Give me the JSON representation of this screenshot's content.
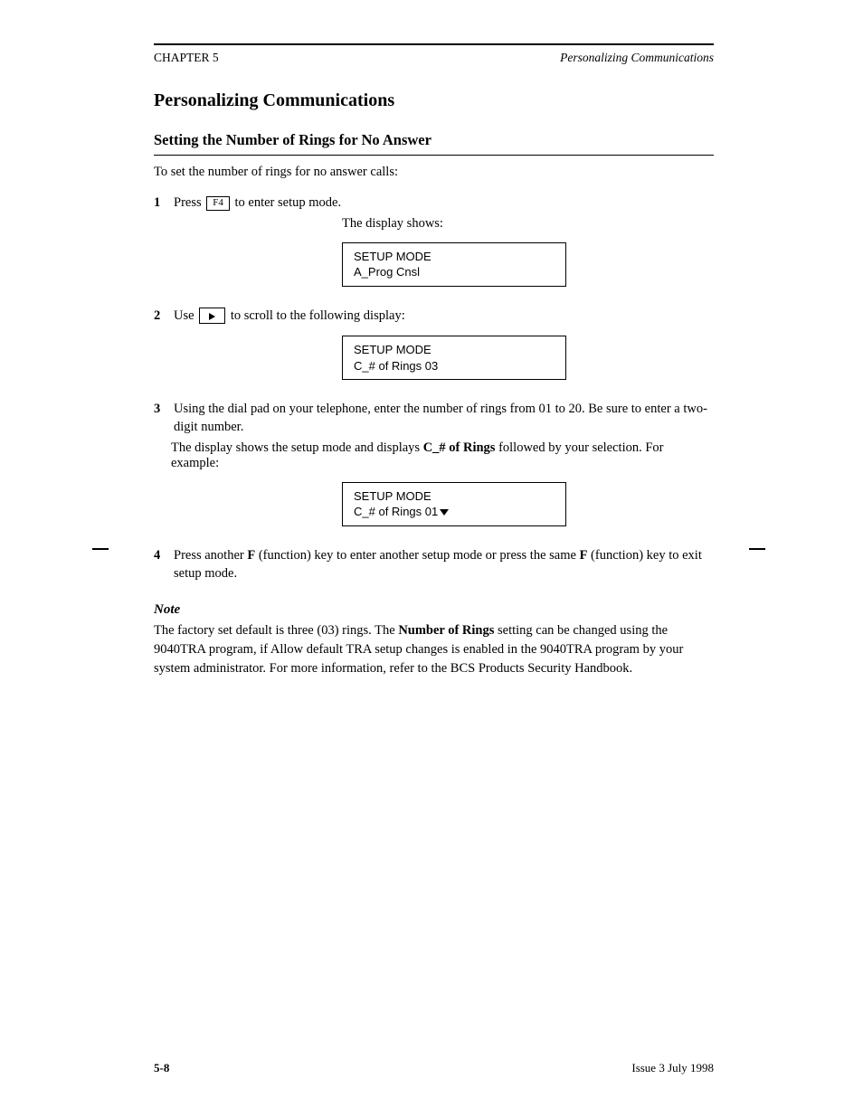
{
  "header": {
    "chapter": "CHAPTER 5",
    "title_italic": "Personalizing Communications"
  },
  "section": {
    "title": "Personalizing Communications",
    "sub_title": "Setting the Number of Rings for No Answer"
  },
  "intro": "To set the number of rings for no answer calls:",
  "steps": {
    "s1": {
      "num": "1",
      "pre": "Press",
      "key": "F4",
      "post": " to enter setup mode."
    },
    "caption1": "The display shows:",
    "display1": {
      "l1": "SETUP MODE",
      "l2": "A_Prog Cnsl"
    },
    "s2": {
      "num": "2",
      "pre": "Use",
      "post": " to scroll to the following display:"
    },
    "display2": {
      "l1": "SETUP MODE",
      "l2": "C_# of Rings 03"
    },
    "s3": {
      "num": "3",
      "text": "Using the dial pad on your telephone, enter the number of rings from 01 to 20. Be sure to enter a two-digit number."
    },
    "caption3_pre": "The display shows the setup mode and displays",
    "caption3_bold": "C_# of Rings",
    "caption3_post": " followed by your selection. For example:",
    "display3": {
      "l1": "SETUP MODE",
      "l2": "C_# of Rings 01"
    },
    "s4": {
      "num": "4",
      "pre": "Press another ",
      "bold1": "F",
      "mid1": " (function) key to enter another setup mode or press the same ",
      "bold2": "F",
      "mid2": " (function) key to exit setup mode."
    }
  },
  "note": {
    "title": "Note",
    "body_pre": "The factory set default is three (03) rings. The ",
    "bold": "Number of Rings",
    "body_post": " setting can be changed using the 9040TRA program, if Allow default TRA setup changes is enabled in the 9040TRA program by your system administrator. For more information, refer to the BCS Products Security Handbook."
  },
  "footer": {
    "page": "5-8",
    "issue": "Issue 3  July 1998"
  }
}
